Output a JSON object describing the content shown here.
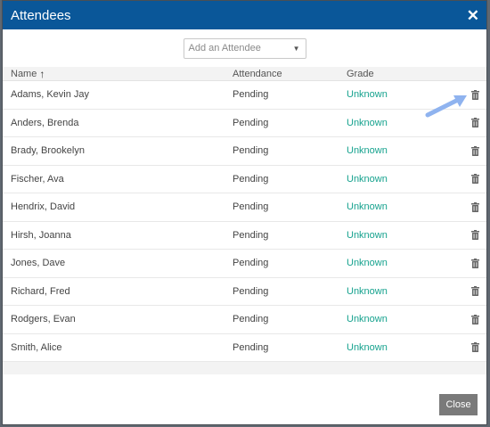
{
  "dialog": {
    "title": "Attendees",
    "close_symbol": "✕",
    "add_placeholder": "Add an Attendee",
    "close_button": "Close"
  },
  "table": {
    "headers": {
      "name": "Name",
      "attendance": "Attendance",
      "grade": "Grade"
    },
    "rows": [
      {
        "name": "Adams, Kevin Jay",
        "attendance": "Pending",
        "grade": "Unknown"
      },
      {
        "name": "Anders, Brenda",
        "attendance": "Pending",
        "grade": "Unknown"
      },
      {
        "name": "Brady, Brookelyn",
        "attendance": "Pending",
        "grade": "Unknown"
      },
      {
        "name": "Fischer, Ava",
        "attendance": "Pending",
        "grade": "Unknown"
      },
      {
        "name": "Hendrix, David",
        "attendance": "Pending",
        "grade": "Unknown"
      },
      {
        "name": "Hirsh, Joanna",
        "attendance": "Pending",
        "grade": "Unknown"
      },
      {
        "name": "Jones, Dave",
        "attendance": "Pending",
        "grade": "Unknown"
      },
      {
        "name": "Richard, Fred",
        "attendance": "Pending",
        "grade": "Unknown"
      },
      {
        "name": "Rodgers, Evan",
        "attendance": "Pending",
        "grade": "Unknown"
      },
      {
        "name": "Smith, Alice",
        "attendance": "Pending",
        "grade": "Unknown"
      }
    ]
  },
  "colors": {
    "header_bg": "#0a5799",
    "grade_text": "#16a28e",
    "close_button_bg": "#7a7a7a",
    "annotation_arrow": "#8fb3ef"
  },
  "icons": {
    "sort": "sort-ascending-icon",
    "delete": "trash-icon",
    "dropdown": "chevron-down-icon"
  }
}
